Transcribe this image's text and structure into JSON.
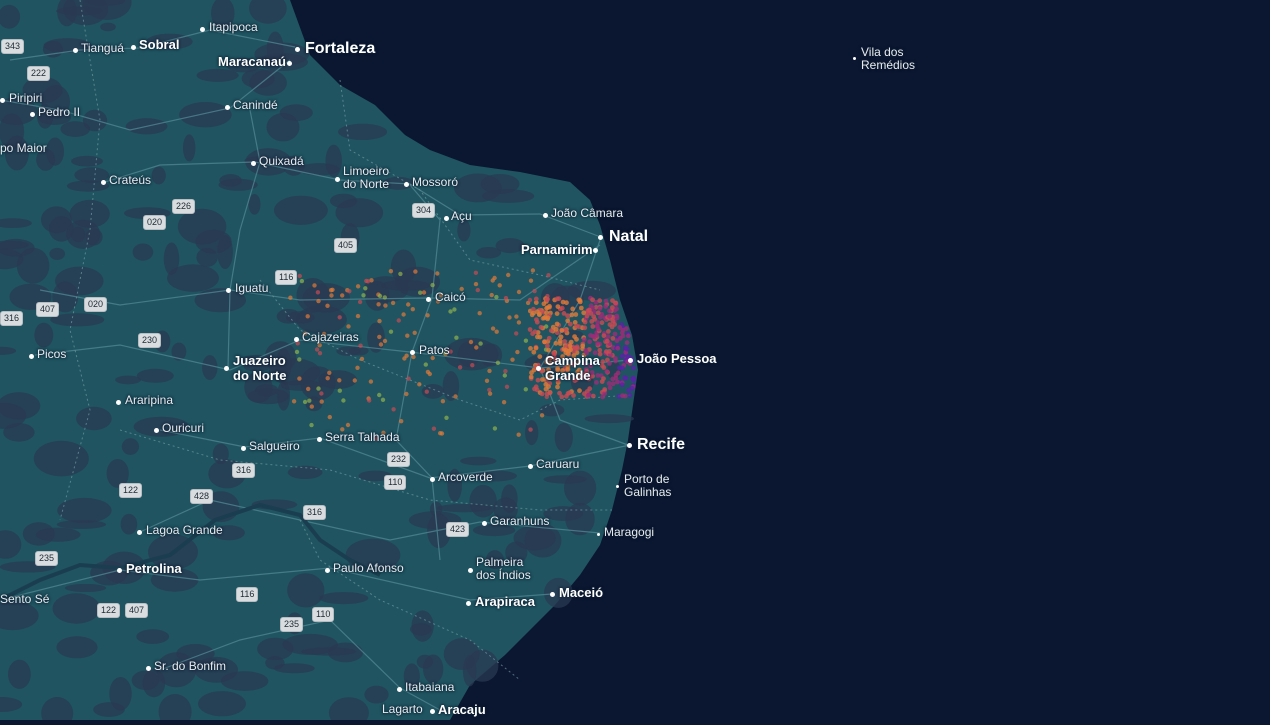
{
  "map": {
    "colors": {
      "ocean": "#0b1630",
      "land": "#1f5460",
      "land_dark": "#2a3a52",
      "roads": "#4f8590",
      "border_dashed": "#6d9aa2",
      "heat_colors": [
        "#e07b3a",
        "#c84b54",
        "#9b2d78",
        "#5a22a8",
        "#8fb04e"
      ]
    },
    "cities": [
      {
        "id": "itapipoca",
        "name": "Itapipoca",
        "size": "small"
      },
      {
        "id": "tiangua",
        "name": "Tianguá",
        "size": "small"
      },
      {
        "id": "sobral",
        "name": "Sobral",
        "size": "medium-bold"
      },
      {
        "id": "maracanau",
        "name": "Maracanaú",
        "size": "medium-bold"
      },
      {
        "id": "fortaleza",
        "name": "Fortaleza",
        "size": "large"
      },
      {
        "id": "vila-dos-remedios",
        "name": "Vila dos\nRemédios",
        "size": "small"
      },
      {
        "id": "piripiri",
        "name": "Piripiri",
        "size": "small"
      },
      {
        "id": "pedro-ii",
        "name": "Pedro II",
        "size": "small"
      },
      {
        "id": "caninde",
        "name": "Canindé",
        "size": "small"
      },
      {
        "id": "campo-maior",
        "name": "po Maior",
        "size": "small"
      },
      {
        "id": "quixada",
        "name": "Quixadá",
        "size": "small"
      },
      {
        "id": "limoeiro",
        "name": "Limoeiro\ndo Norte",
        "size": "small"
      },
      {
        "id": "mossoro",
        "name": "Mossoró",
        "size": "small"
      },
      {
        "id": "crateus",
        "name": "Crateús",
        "size": "small"
      },
      {
        "id": "acu",
        "name": "Açu",
        "size": "small"
      },
      {
        "id": "joao-camara",
        "name": "João Câmara",
        "size": "small"
      },
      {
        "id": "natal",
        "name": "Natal",
        "size": "large"
      },
      {
        "id": "parnamirim",
        "name": "Parnamirim",
        "size": "medium-bold"
      },
      {
        "id": "iguatu",
        "name": "Iguatu",
        "size": "small"
      },
      {
        "id": "caico",
        "name": "Caicó",
        "size": "small"
      },
      {
        "id": "cajazeiras",
        "name": "Cajazeiras",
        "size": "small"
      },
      {
        "id": "patos",
        "name": "Patos",
        "size": "small"
      },
      {
        "id": "picos",
        "name": "Picos",
        "size": "small"
      },
      {
        "id": "juazeiro",
        "name": "Juazeiro\ndo Norte",
        "size": "medium-bold"
      },
      {
        "id": "campina-grande",
        "name": "Campina\nGrande",
        "size": "medium-bold"
      },
      {
        "id": "joao-pessoa",
        "name": "João Pessoa",
        "size": "medium-bold"
      },
      {
        "id": "araripina",
        "name": "Araripina",
        "size": "small"
      },
      {
        "id": "ouricuri",
        "name": "Ouricuri",
        "size": "small"
      },
      {
        "id": "serra-talhada",
        "name": "Serra Talhada",
        "size": "small"
      },
      {
        "id": "salgueiro",
        "name": "Salgueiro",
        "size": "small"
      },
      {
        "id": "caruaru",
        "name": "Caruaru",
        "size": "small"
      },
      {
        "id": "recife",
        "name": "Recife",
        "size": "large"
      },
      {
        "id": "arcoverde",
        "name": "Arcoverde",
        "size": "small"
      },
      {
        "id": "porto-de-galinhas",
        "name": "Porto de\nGalinhas",
        "size": "small"
      },
      {
        "id": "garanhuns",
        "name": "Garanhuns",
        "size": "small"
      },
      {
        "id": "maragogi",
        "name": "Maragogi",
        "size": "small"
      },
      {
        "id": "lagoa-grande",
        "name": "Lagoa Grande",
        "size": "small"
      },
      {
        "id": "petrolina",
        "name": "Petrolina",
        "size": "medium-bold"
      },
      {
        "id": "paulo-afonso",
        "name": "Paulo Afonso",
        "size": "small"
      },
      {
        "id": "palmeira",
        "name": "Palmeira\ndos Índios",
        "size": "small"
      },
      {
        "id": "sento-se",
        "name": "Sento Sé",
        "size": "small"
      },
      {
        "id": "arapiraca",
        "name": "Arapiraca",
        "size": "medium-bold"
      },
      {
        "id": "maceio",
        "name": "Maceió",
        "size": "medium-bold"
      },
      {
        "id": "senhor-do-bonfim",
        "name": "Sr. do Bonfim",
        "size": "small"
      },
      {
        "id": "itabaiana",
        "name": "Itabaiana",
        "size": "small"
      },
      {
        "id": "lagarto",
        "name": "Lagarto",
        "size": "small"
      },
      {
        "id": "aracaju",
        "name": "Aracaju",
        "size": "medium-bold"
      }
    ],
    "shields": [
      {
        "id": "s343",
        "label": "343"
      },
      {
        "id": "s222",
        "label": "222"
      },
      {
        "id": "s226",
        "label": "226"
      },
      {
        "id": "s020a",
        "label": "020"
      },
      {
        "id": "s304",
        "label": "304"
      },
      {
        "id": "s405",
        "label": "405"
      },
      {
        "id": "s116a",
        "label": "116"
      },
      {
        "id": "s407a",
        "label": "407"
      },
      {
        "id": "s020b",
        "label": "020"
      },
      {
        "id": "s316a",
        "label": "316"
      },
      {
        "id": "s230",
        "label": "230"
      },
      {
        "id": "s232",
        "label": "232"
      },
      {
        "id": "s316b",
        "label": "316"
      },
      {
        "id": "s110a",
        "label": "110"
      },
      {
        "id": "s122a",
        "label": "122"
      },
      {
        "id": "s428",
        "label": "428"
      },
      {
        "id": "s316c",
        "label": "316"
      },
      {
        "id": "s423",
        "label": "423"
      },
      {
        "id": "s235a",
        "label": "235"
      },
      {
        "id": "s122b",
        "label": "122"
      },
      {
        "id": "s407b",
        "label": "407"
      },
      {
        "id": "s116b",
        "label": "116"
      },
      {
        "id": "s235b",
        "label": "235"
      },
      {
        "id": "s110b",
        "label": "110"
      }
    ]
  }
}
